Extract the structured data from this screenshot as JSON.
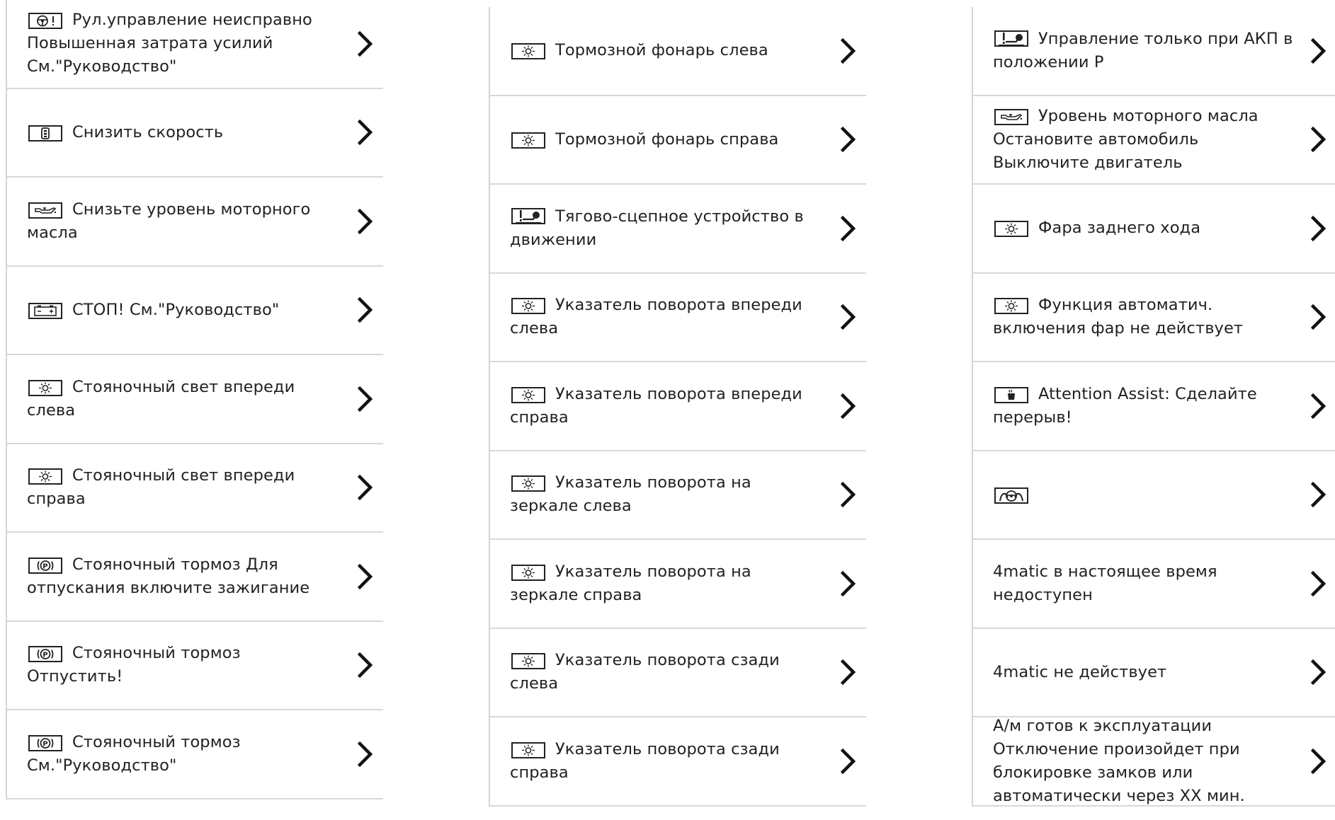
{
  "columns": [
    {
      "items": [
        {
          "icon": "steering-warning-icon",
          "text": "Рул.управление неисправно Повышенная затрата усилий См.\"Руко­водство\""
        },
        {
          "icon": "speed-reduce-icon",
          "text": "Снизить скорость"
        },
        {
          "icon": "oil-can-icon",
          "text": "Снизьте уровень моторного масла"
        },
        {
          "icon": "battery-icon",
          "text": "СТОП! См.\"Руководство\""
        },
        {
          "icon": "lamp-icon",
          "text": "Стояночный свет впереди слева"
        },
        {
          "icon": "lamp-icon",
          "text": "Стояночный свет впереди справа"
        },
        {
          "icon": "parking-brake-icon",
          "text": "Стояночный тормоз Для отпуска­ния включите зажигание"
        },
        {
          "icon": "parking-brake-icon",
          "text": "Стояночный тормоз Отпустить!"
        },
        {
          "icon": "parking-brake-icon",
          "text": "Стояночный тормоз См.\"Руковод­ство\""
        }
      ]
    },
    {
      "items": [
        {
          "icon": "lamp-icon",
          "text": "Тормозной фонарь слева"
        },
        {
          "icon": "lamp-icon",
          "text": "Тормозной фонарь справа"
        },
        {
          "icon": "tow-hitch-icon",
          "text": "Тягово-сцепное устройство в движении"
        },
        {
          "icon": "lamp-icon",
          "text": "Указатель поворота впереди слева"
        },
        {
          "icon": "lamp-icon",
          "text": "Указатель поворота впереди справа"
        },
        {
          "icon": "lamp-icon",
          "text": "Указатель поворота на зеркале слева"
        },
        {
          "icon": "lamp-icon",
          "text": "Указатель поворота на зеркале справа"
        },
        {
          "icon": "lamp-icon",
          "text": "Указатель поворота сзади слева"
        },
        {
          "icon": "lamp-icon",
          "text": "Указатель поворота сзади справа"
        }
      ]
    },
    {
      "items": [
        {
          "icon": "tow-hitch-icon",
          "text": "Управление только при АКП в положении P"
        },
        {
          "icon": "oil-can-icon",
          "text": "Уровень моторного масла Оста­новите автомобиль Выключите двига­тель"
        },
        {
          "icon": "lamp-icon",
          "text": "Фара заднего хода"
        },
        {
          "icon": "lamp-icon",
          "text": "Функция автоматич. включения фар не действует"
        },
        {
          "icon": "coffee-cup-icon",
          "text": "Attention Assist: Сделайте пере­рыв!"
        },
        {
          "icon": "steering-hands-icon",
          "text": ""
        },
        {
          "icon": "",
          "text": "4matic в настоящее время недоступен"
        },
        {
          "icon": "",
          "text": "4matic не действует"
        },
        {
          "icon": "",
          "text": "А/м готов к эксплуатации Отключение произойдет при блокировке замков или автоматически через XX мин."
        }
      ]
    }
  ],
  "chevron_icon": "chevron-right-icon"
}
